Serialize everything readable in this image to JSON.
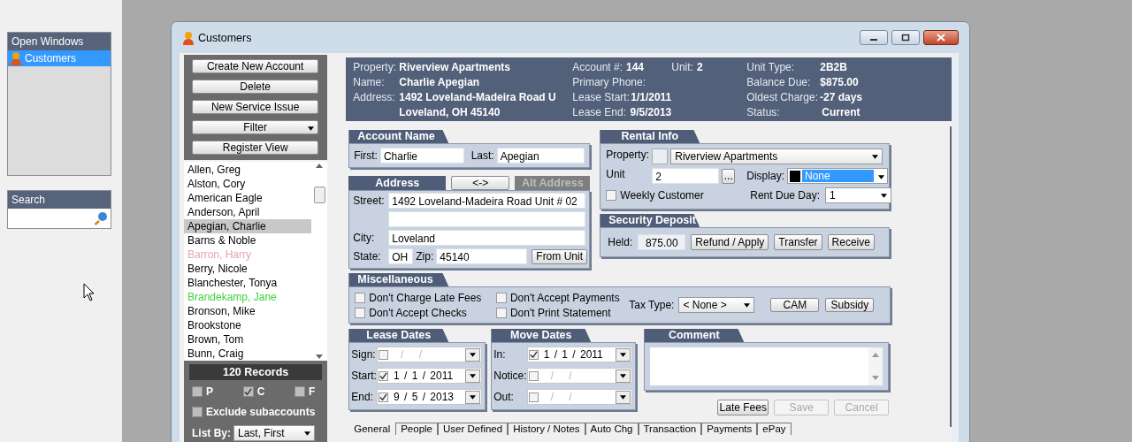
{
  "window": {
    "title": "Customers"
  },
  "sidebar": {
    "open_windows": {
      "title": "Open Windows",
      "items": [
        {
          "label": "Customers",
          "selected": true
        }
      ]
    },
    "search": {
      "title": "Search"
    }
  },
  "actions": [
    {
      "label": "Create New Account",
      "kind": "button"
    },
    {
      "label": "Delete",
      "kind": "button"
    },
    {
      "label": "New Service Issue",
      "kind": "button"
    },
    {
      "label": "Filter",
      "kind": "menu"
    },
    {
      "label": "Register View",
      "kind": "button"
    }
  ],
  "customers": [
    {
      "name": "Allen, Greg",
      "selected": false,
      "color": "#000000"
    },
    {
      "name": "Alston, Cory",
      "selected": false,
      "color": "#000000"
    },
    {
      "name": "American Eagle",
      "selected": false,
      "color": "#000000"
    },
    {
      "name": "Anderson, April",
      "selected": false,
      "color": "#000000"
    },
    {
      "name": "Apegian, Charlie",
      "selected": true,
      "color": "#000000"
    },
    {
      "name": "Barns & Noble",
      "selected": false,
      "color": "#000000"
    },
    {
      "name": "Barron, Harry",
      "selected": false,
      "color": "#e8a4ac"
    },
    {
      "name": "Berry, Nicole",
      "selected": false,
      "color": "#000000"
    },
    {
      "name": "Blanchester, Tonya",
      "selected": false,
      "color": "#000000"
    },
    {
      "name": "Brandekamp, Jane",
      "selected": false,
      "color": "#3ed23e"
    },
    {
      "name": "Bronson, Mike",
      "selected": false,
      "color": "#000000"
    },
    {
      "name": "Brookstone",
      "selected": false,
      "color": "#000000"
    },
    {
      "name": "Brown, Tom",
      "selected": false,
      "color": "#000000"
    },
    {
      "name": "Bunn, Craig",
      "selected": false,
      "color": "#000000"
    }
  ],
  "records": "120 Records",
  "type_filters": [
    {
      "label": "P",
      "checked": false
    },
    {
      "label": "C",
      "checked": true
    },
    {
      "label": "F",
      "checked": false
    }
  ],
  "exclude_subaccounts": {
    "label": "Exclude subaccounts",
    "checked": false
  },
  "list_by": {
    "label": "List By:",
    "value": "Last, First"
  },
  "summary": {
    "columns": [
      [
        {
          "label": "Property:",
          "value": "Riverview Apartments"
        },
        {
          "label": "Name:",
          "value": "Charlie Apegian"
        },
        {
          "label": "Address:",
          "value": "1492 Loveland-Madeira Road U"
        },
        {
          "value": "Loveland, OH 45140"
        }
      ],
      [
        {
          "label": "Account #:",
          "value": "144"
        },
        {
          "label": "Primary Phone:"
        },
        {
          "label": "Lease Start:",
          "value": "1/1/2011"
        },
        {
          "label": "Lease End:",
          "value": "9/5/2013"
        }
      ],
      [
        {
          "label": "Unit:",
          "value": "2"
        }
      ],
      [
        {
          "label": "Unit Type:",
          "value": "2B2B"
        },
        {
          "label": "Balance Due:",
          "value": "$875.00"
        },
        {
          "label": "Oldest Charge:",
          "value": "-27 days"
        },
        {
          "label": "Status:",
          "value": "Current"
        }
      ]
    ]
  },
  "account_name": {
    "title": "Account Name",
    "first": {
      "label": "First:",
      "value": "Charlie"
    },
    "last": {
      "label": "Last:",
      "value": "Apegian"
    }
  },
  "address": {
    "title": "Address",
    "swap": "<->",
    "alt_tab": {
      "label": "Alt Address",
      "disabled": true
    },
    "street": {
      "label": "Street:",
      "value": "1492 Loveland-Madeira Road Unit # 02"
    },
    "city": {
      "label": "City:",
      "value": "Loveland"
    },
    "state": {
      "label": "State:",
      "value": "OH"
    },
    "zip": {
      "label": "Zip:",
      "value": "45140"
    },
    "from_unit": "From Unit"
  },
  "rental_info": {
    "title": "Rental Info",
    "property": {
      "label": "Property:",
      "value": "Riverview Apartments"
    },
    "unit": {
      "label": "Unit",
      "value": "2",
      "more": "..."
    },
    "display": {
      "label": "Display:",
      "value": "None"
    },
    "weekly_customer": {
      "label": "Weekly Customer",
      "checked": false
    },
    "rent_due_day": {
      "label": "Rent Due Day:",
      "value": "1"
    }
  },
  "security_deposit": {
    "title": "Security Deposit",
    "held": {
      "label": "Held:",
      "value": "875.00"
    },
    "buttons": [
      "Refund / Apply",
      "Transfer",
      "Receive"
    ]
  },
  "miscellaneous": {
    "title": "Miscellaneous",
    "options": [
      {
        "label": "Don't Charge Late Fees",
        "checked": false
      },
      {
        "label": "Don't Accept Checks",
        "checked": false
      },
      {
        "label": "Don't Accept Payments",
        "checked": false
      },
      {
        "label": "Don't Print Statement",
        "checked": false
      }
    ],
    "tax_type": {
      "label": "Tax Type:",
      "value": "< None >"
    },
    "buttons": [
      "CAM",
      "Subsidy"
    ]
  },
  "lease_dates": {
    "title": "Lease Dates",
    "dates": [
      {
        "label": "Sign:",
        "checked": false,
        "placeholder": "/ /"
      },
      {
        "label": "Start:",
        "checked": true,
        "value": "1 / 1 / 2011"
      },
      {
        "label": "End:",
        "checked": true,
        "value": "9 / 5 / 2013"
      }
    ]
  },
  "move_dates": {
    "title": "Move Dates",
    "dates": [
      {
        "label": "In:",
        "checked": true,
        "value": "1 / 1 / 2011"
      },
      {
        "label": "Notice:",
        "checked": false,
        "placeholder": "/ /"
      },
      {
        "label": "Out:",
        "checked": false,
        "placeholder": "/ /"
      }
    ]
  },
  "comment": {
    "title": "Comment"
  },
  "form_buttons": [
    {
      "label": "Late Fees",
      "disabled": false
    },
    {
      "label": "Save",
      "disabled": true
    },
    {
      "label": "Cancel",
      "disabled": true
    }
  ],
  "tabs": [
    {
      "label": "General",
      "selected": true
    },
    {
      "label": "People",
      "selected": false
    },
    {
      "label": "User Defined",
      "selected": false
    },
    {
      "label": "History / Notes",
      "selected": false
    },
    {
      "label": "Auto Chg",
      "selected": false
    },
    {
      "label": "Transaction",
      "selected": false
    },
    {
      "label": "Payments",
      "selected": false
    },
    {
      "label": "ePay",
      "selected": false
    }
  ]
}
